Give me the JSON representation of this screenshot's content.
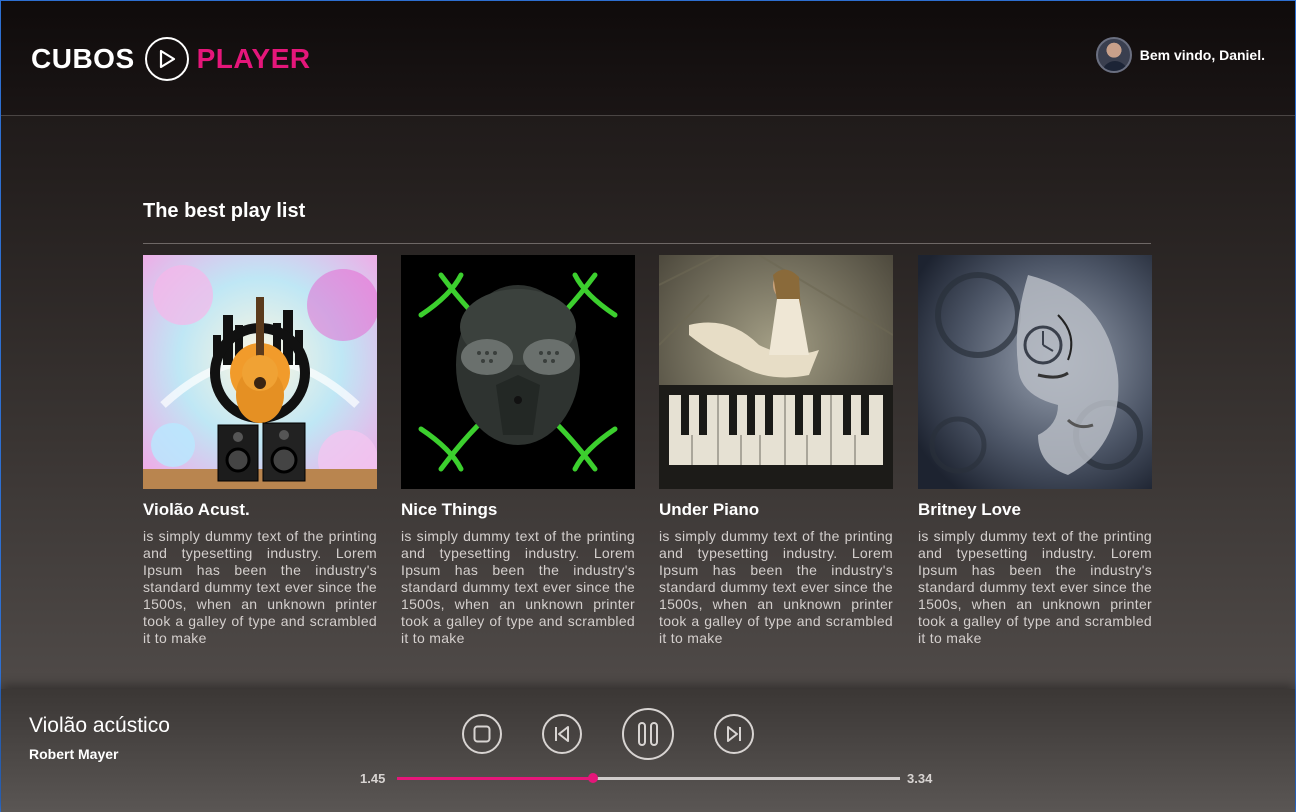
{
  "brand": {
    "word1": "CUBOS",
    "word2": "PLAYER",
    "accent": "#e5167a",
    "icon": "play-circle-icon"
  },
  "user": {
    "welcome": "Bem vindo, Daniel."
  },
  "playlist": {
    "title": "The best play list",
    "cards": [
      {
        "title": "Violão Acust.",
        "image": "guitar-speakers-art",
        "desc": "is simply dummy text of the printing and typesetting industry. Lorem Ipsum has been the industry's standard dummy text ever since the 1500s, when an unknown printer took a galley of type and scrambled it to make"
      },
      {
        "title": "Nice Things",
        "image": "mask-art",
        "desc": "is simply dummy text of the printing and typesetting industry. Lorem Ipsum has been the industry's standard dummy text ever since the 1500s, when an unknown printer took a galley of type and scrambled it to make"
      },
      {
        "title": "Under Piano",
        "image": "piano-woman-art",
        "desc": "is simply dummy text of the printing and typesetting industry. Lorem Ipsum has been the industry's standard dummy text ever since the 1500s, when an unknown printer took a galley of type and scrambled it to make"
      },
      {
        "title": "Britney Love",
        "image": "face-clock-art",
        "desc": "is simply dummy text of the printing and typesetting industry. Lorem Ipsum has been the industry's standard dummy text ever since the 1500s, when an unknown printer took a galley of type and scrambled it to make"
      }
    ]
  },
  "player": {
    "title": "Violão acústico",
    "artist": "Robert Mayer",
    "current_time": "1.45",
    "total_time": "3.34",
    "progress": 0.39,
    "controls": [
      "stop-icon",
      "previous-icon",
      "pause-icon",
      "next-icon"
    ]
  }
}
